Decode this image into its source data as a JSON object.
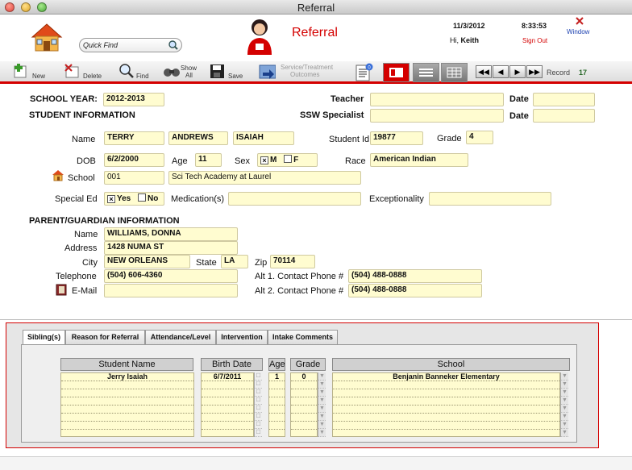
{
  "window": {
    "title": "Referral"
  },
  "header": {
    "app_title": "Referral",
    "quick_find_placeholder": "Quick Find",
    "date": "11/3/2012",
    "time": "8:33:53",
    "greeting": "Hi,",
    "user": "Keith",
    "sign_out": "Sign Out",
    "window_link": "Window"
  },
  "toolbar": {
    "new": "New",
    "delete": "Delete",
    "find": "Find",
    "show_all_1": "Show",
    "show_all_2": "All",
    "save": "Save",
    "service_1": "Service/Treatment",
    "service_2": "Outcomes",
    "record_label": "Record",
    "record_value": "17",
    "badge": "0"
  },
  "form": {
    "school_year_label": "SCHOOL YEAR:",
    "school_year": "2012-2013",
    "teacher_label": "Teacher",
    "teacher": "",
    "date_label": "Date",
    "teacher_date": "",
    "student_info_label": "STUDENT INFORMATION",
    "ssw_label": "SSW Specialist",
    "ssw": "",
    "ssw_date": "",
    "name_label": "Name",
    "first_name": "TERRY",
    "last_name": "ANDREWS",
    "middle_name": "ISAIAH",
    "student_id_label": "Student Id",
    "student_id": "19877",
    "grade_label": "Grade",
    "grade": "4",
    "dob_label": "DOB",
    "dob": "6/2/2000",
    "age_label": "Age",
    "age": "11",
    "sex_label": "Sex",
    "sex_m": "M",
    "sex_f": "F",
    "race_label": "Race",
    "race": "American Indian",
    "school_label": "School",
    "school_code": "001",
    "school_name": "Sci Tech Academy at Laurel",
    "special_ed_label": "Special Ed",
    "yes": "Yes",
    "no": "No",
    "medication_label": "Medication(s)",
    "medication": "",
    "exceptionality_label": "Exceptionality",
    "exceptionality": ""
  },
  "parent": {
    "section_label": "PARENT/GUARDIAN INFORMATION",
    "name_label": "Name",
    "name": "WILLIAMS, DONNA",
    "address_label": "Address",
    "address": "1428 NUMA ST",
    "city_label": "City",
    "city": "NEW ORLEANS",
    "state_label": "State",
    "state": "LA",
    "zip_label": "Zip",
    "zip": "70114",
    "phone_label": "Telephone",
    "phone": "(504) 606-4360",
    "alt1_label": "Alt 1. Contact Phone #",
    "alt1": "(504) 488-0888",
    "email_label": "E-Mail",
    "email": "",
    "alt2_label": "Alt 2. Contact Phone #",
    "alt2": "(504) 488-0888"
  },
  "tabs": [
    "Sibling(s)",
    "Reason for Referral",
    "Attendance/Level",
    "Intervention",
    "Intake Comments"
  ],
  "siblings": {
    "headers": [
      "Student Name",
      "Birth Date",
      "Age",
      "Grade",
      "School"
    ],
    "rows": [
      {
        "name": "Jerry Isaiah",
        "birth": "6/7/2011",
        "age": "1",
        "grade": "0",
        "school": "Benjanin Banneker Elementary"
      }
    ]
  },
  "colors": {
    "accent": "#d40000",
    "field_bg": "#fffcd0",
    "link_blue": "#1a3fb0"
  }
}
